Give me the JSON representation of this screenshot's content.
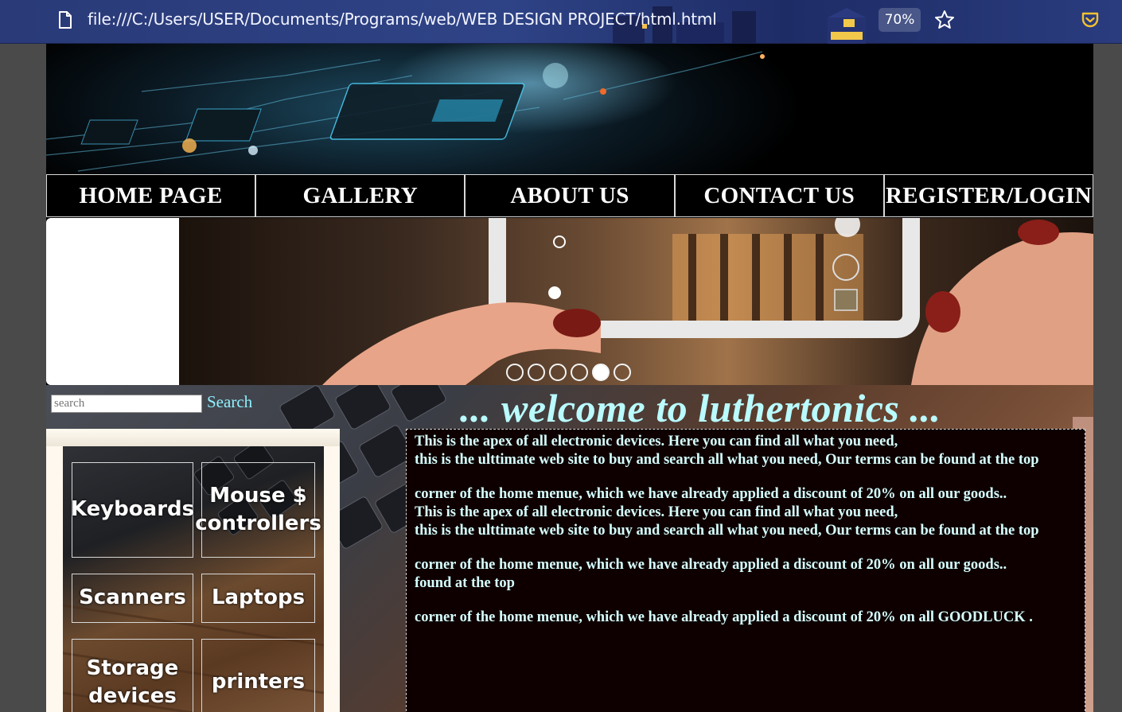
{
  "browser": {
    "url": "file:///C:/Users/USER/Documents/Programs/web/WEB DESIGN PROJECT/html.html",
    "zoom": "70%",
    "icons": [
      "page-icon",
      "star-icon",
      "pocket-icon"
    ]
  },
  "nav": {
    "items": [
      "HOME PAGE",
      "GALLERY",
      "ABOUT US",
      "CONTACT US",
      "REGISTER/LOGIN"
    ]
  },
  "slider": {
    "dot_count": 6,
    "active_dot": 5
  },
  "search": {
    "placeholder": "search",
    "button_label": "Search"
  },
  "categories": {
    "items": [
      {
        "label": "Keyboards"
      },
      {
        "label": "Mouse $ controllers"
      },
      {
        "label": "Scanners"
      },
      {
        "label": "Laptops"
      },
      {
        "label": "Storage devices"
      },
      {
        "label": "printers"
      }
    ]
  },
  "welcome": {
    "title": "... welcome to luthertonics ..."
  },
  "intro": {
    "lines": [
      "This is the apex of all electronic devices. Here you can find all what you need,",
      "this is the ulttimate web site to buy and search all what you need, Our terms can be found at the top",
      "corner of the home menue, which we have already applied a discount of 20% on all our goods..",
      "This is the apex of all electronic devices. Here you can find all what you need,",
      "this is the ulttimate web site to buy and search all what you need, Our terms can be found at the top",
      "corner of the home menue, which we have already applied a discount of 20% on all our goods..",
      "found at the top",
      "corner of the home menue, which we have already applied a discount of 20% on all GOODLUCK ."
    ]
  },
  "colors": {
    "nav_bg": "#000000",
    "nav_text": "#ffffff",
    "welcome_text": "#b9fbff",
    "intro_text": "#d6ffff",
    "intro_bg": "#0e0000",
    "search_button": "#8ff0ff"
  }
}
